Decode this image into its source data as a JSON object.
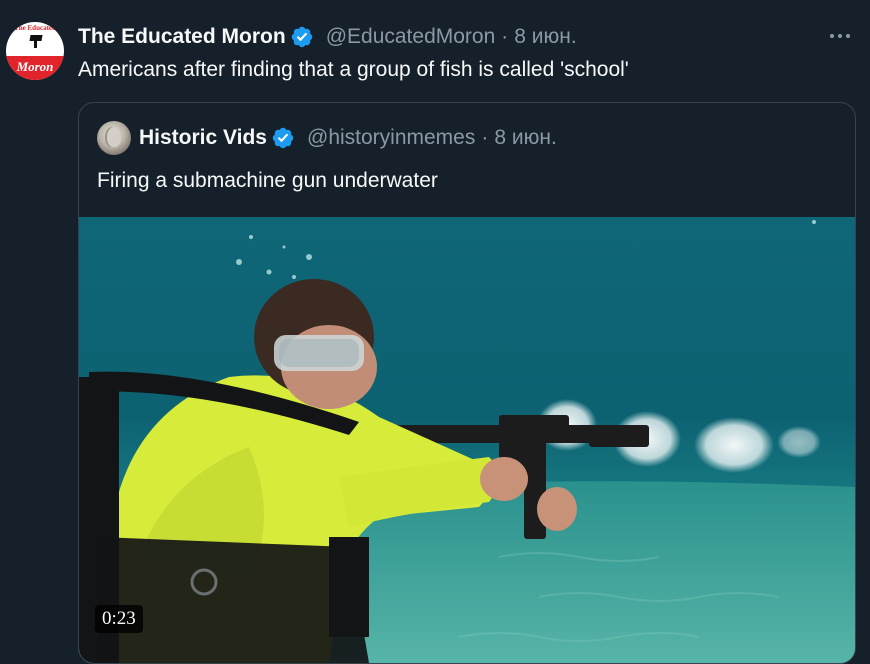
{
  "tweet": {
    "display_name": "The Educated Moron",
    "handle": "@EducatedMoron",
    "separator": "·",
    "date": "8 июн.",
    "text": "Americans after finding that a group of fish is called 'school'",
    "avatar": {
      "top_text": "The Educated",
      "word": "Moron",
      "colors": {
        "banner": "#e0242a",
        "background": "#ffffff"
      }
    },
    "more_icon": "more-horizontal-icon"
  },
  "quoted_tweet": {
    "display_name": "Historic Vids",
    "handle": "@historyinmemes",
    "separator": "·",
    "date": "8 июн.",
    "text": "Firing a submachine gun underwater",
    "media": {
      "type": "video",
      "duration": "0:23",
      "description_icon": "video-thumbnail"
    }
  },
  "colors": {
    "background": "#15202b",
    "text_primary": "#f7f9f9",
    "text_secondary": "#8b98a5",
    "verified_badge": "#1d9bf0",
    "border": "#38444d"
  }
}
